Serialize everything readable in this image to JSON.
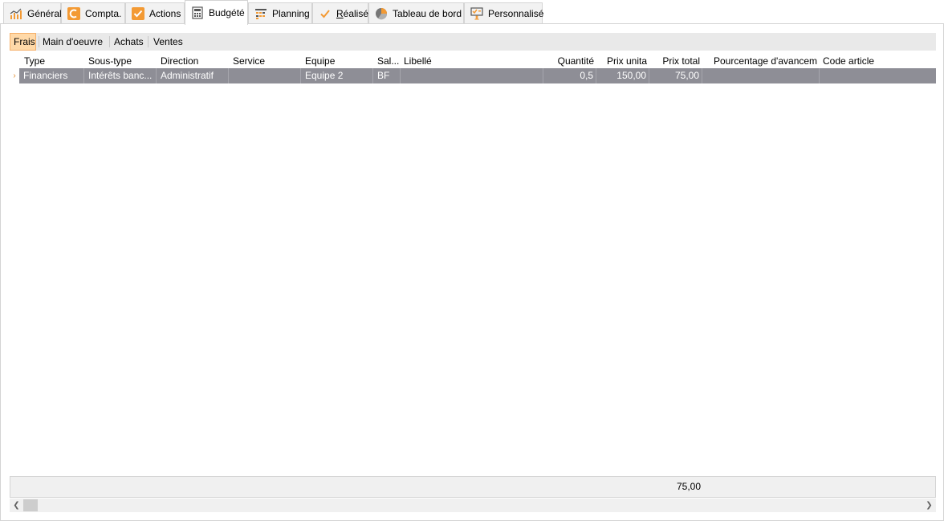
{
  "tabs": [
    {
      "label": "Général",
      "icon": "line-chart-icon"
    },
    {
      "label": "Compta.",
      "icon": "compta-icon"
    },
    {
      "label": "Actions",
      "icon": "checkbox-icon"
    },
    {
      "label": "Budgété",
      "icon": "calculator-icon",
      "active": true
    },
    {
      "label": "Planning",
      "icon": "planning-icon"
    },
    {
      "label": "Réalisé",
      "icon": "checkmark-icon"
    },
    {
      "label": "Tableau de bord",
      "icon": "pie-chart-icon"
    },
    {
      "label": "Personnalisé",
      "icon": "custom-icon"
    }
  ],
  "subtabs": [
    {
      "label": "Frais",
      "active": true
    },
    {
      "label": "Main d'oeuvre"
    },
    {
      "label": "Achats"
    },
    {
      "label": "Ventes"
    }
  ],
  "grid": {
    "columns": [
      "Type",
      "Sous-type",
      "Direction",
      "Service",
      "Equipe",
      "Sal...",
      "Libellé",
      "Quantité",
      "Prix unita",
      "Prix total",
      "Pourcentage d'avancem",
      "Code article"
    ],
    "rows": [
      {
        "type": "Financiers",
        "sous_type": "Intérêts banc...",
        "direction": "Administratif",
        "service": "",
        "equipe": "Equipe 2",
        "sal": "BF",
        "libelle": "",
        "quantite": "0,5",
        "prix_unitaire": "150,00",
        "prix_total": "75,00",
        "pourcentage": "",
        "code_article": ""
      }
    ],
    "row_indicator": "›"
  },
  "footer": {
    "prix_total_sum": "75,00"
  },
  "colors": {
    "accent": "#f39a34",
    "selected_row": "#8e8e96",
    "active_subtab": "#ffd9a8"
  }
}
